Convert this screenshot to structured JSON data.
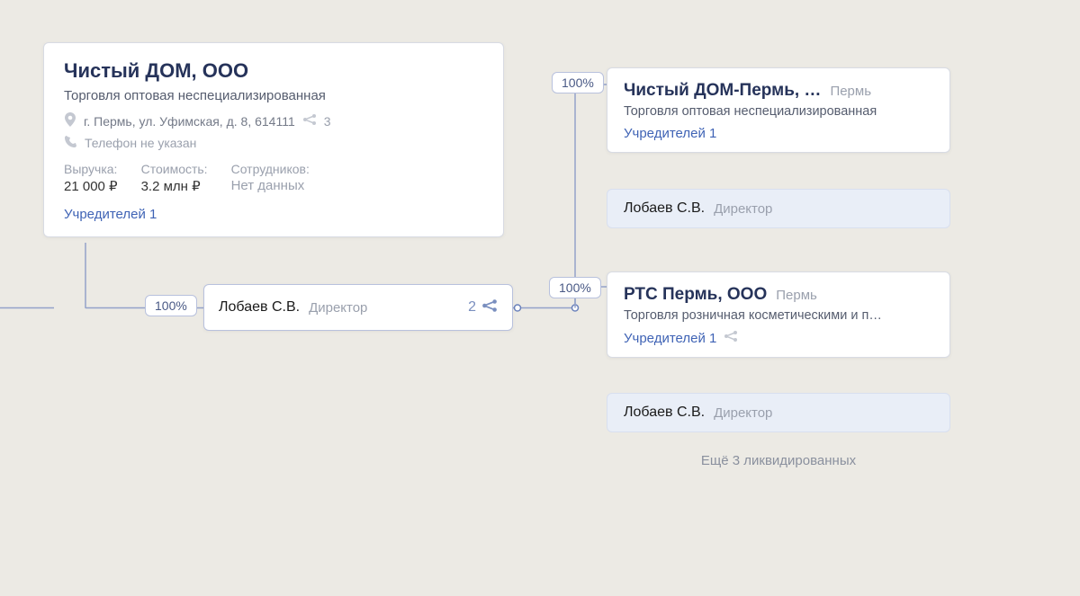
{
  "main": {
    "title": "Чистый ДОМ, ООО",
    "description": "Торговля оптовая неспециализированная",
    "address": "г. Пермь, ул. Уфимская, д. 8, 614111",
    "address_share_count": "3",
    "phone": "Телефон не указан",
    "metrics": {
      "revenue_label": "Выручка:",
      "revenue_value": "21 000 ₽",
      "cost_label": "Стоимость:",
      "cost_value": "3.2 млн ₽",
      "employees_label": "Сотрудников:",
      "employees_value": "Нет данных"
    },
    "founders": "Учредителей 1"
  },
  "person": {
    "name": "Лобаев С.В.",
    "role": "Директор",
    "connections": "2"
  },
  "badges": {
    "b1": "100%",
    "b2": "100%",
    "b3": "100%"
  },
  "subsidiaries": [
    {
      "title": "Чистый ДОМ-Пермь, …",
      "city": "Пермь",
      "description": "Торговля оптовая неспециализированная",
      "founders": "Учредителей 1",
      "director_name": "Лобаев С.В.",
      "director_role": "Директор",
      "has_share_icon": false
    },
    {
      "title": "РТС Пермь, ООО",
      "city": "Пермь",
      "description": "Торговля розничная косметическими и п…",
      "founders": "Учредителей 1",
      "director_name": "Лобаев С.В.",
      "director_role": "Директор",
      "has_share_icon": true
    }
  ],
  "more": "Ещё 3 ликвидированных"
}
